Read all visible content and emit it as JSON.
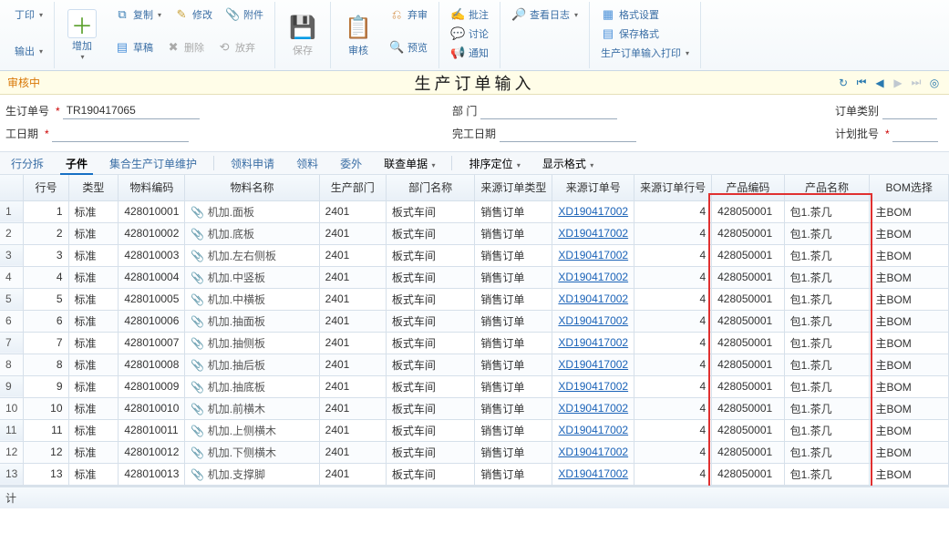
{
  "toolbar": {
    "print": "丁印",
    "export": "输出",
    "add": "增加",
    "copy": "复制",
    "modify": "修改",
    "attachment": "附件",
    "draft": "草稿",
    "delete": "删除",
    "discard": "放弃",
    "save": "保存",
    "audit": "审核",
    "abandon": "弃审",
    "preview": "预览",
    "annotate": "批注",
    "discuss": "讨论",
    "notify": "通知",
    "viewlog": "查看日志",
    "formatset": "格式设置",
    "saveformat": "保存格式",
    "printorder": "生产订单输入打印"
  },
  "status": {
    "text": "审核中"
  },
  "title": "生产订单输入",
  "form": {
    "orderNoLbl": "生订单号",
    "orderNoVal": "TR190417065",
    "deptLbl": "部 门",
    "orderTypeLbl": "订单类别",
    "workDateLbl": "工日期",
    "finishDateLbl": "完工日期",
    "planBatchLbl": "计划批号"
  },
  "tabs": {
    "split": "行分拆",
    "child": "子件",
    "maintain": "集合生产订单维护",
    "apply": "领料申请",
    "pick": "领料",
    "outsource": "委外",
    "linkquery": "联查单据",
    "sortlocate": "排序定位",
    "dispformat": "显示格式"
  },
  "cols": {
    "rowno": "行号",
    "type": "类型",
    "matcode": "物料编码",
    "matname": "物料名称",
    "proddept": "生产部门",
    "deptname": "部门名称",
    "srctype": "来源订单类型",
    "srcno": "来源订单号",
    "srcrow": "来源订单行号",
    "prodcode": "产品编码",
    "prodname": "产品名称",
    "bom": "BOM选择"
  },
  "common": {
    "type": "标准",
    "dept": "2401",
    "deptName": "板式车间",
    "srcType": "销售订单",
    "srcNo": "XD190417002",
    "srcRow": "4",
    "prodCode": "428050001",
    "prodName": "包1.茶几",
    "bom": "主BOM"
  },
  "rows": [
    {
      "n": 1,
      "code": "428010001",
      "name": "机加.面板"
    },
    {
      "n": 2,
      "code": "428010002",
      "name": "机加.底板"
    },
    {
      "n": 3,
      "code": "428010003",
      "name": "机加.左右侧板"
    },
    {
      "n": 4,
      "code": "428010004",
      "name": "机加.中竖板"
    },
    {
      "n": 5,
      "code": "428010005",
      "name": "机加.中横板"
    },
    {
      "n": 6,
      "code": "428010006",
      "name": "机加.抽面板"
    },
    {
      "n": 7,
      "code": "428010007",
      "name": "机加.抽侧板"
    },
    {
      "n": 8,
      "code": "428010008",
      "name": "机加.抽后板"
    },
    {
      "n": 9,
      "code": "428010009",
      "name": "机加.抽底板"
    },
    {
      "n": 10,
      "code": "428010010",
      "name": "机加.前横木"
    },
    {
      "n": 11,
      "code": "428010011",
      "name": "机加.上侧横木"
    },
    {
      "n": 12,
      "code": "428010012",
      "name": "机加.下侧横木"
    },
    {
      "n": 13,
      "code": "428010013",
      "name": "机加.支撑脚"
    }
  ],
  "footer": {
    "sum": "计"
  }
}
